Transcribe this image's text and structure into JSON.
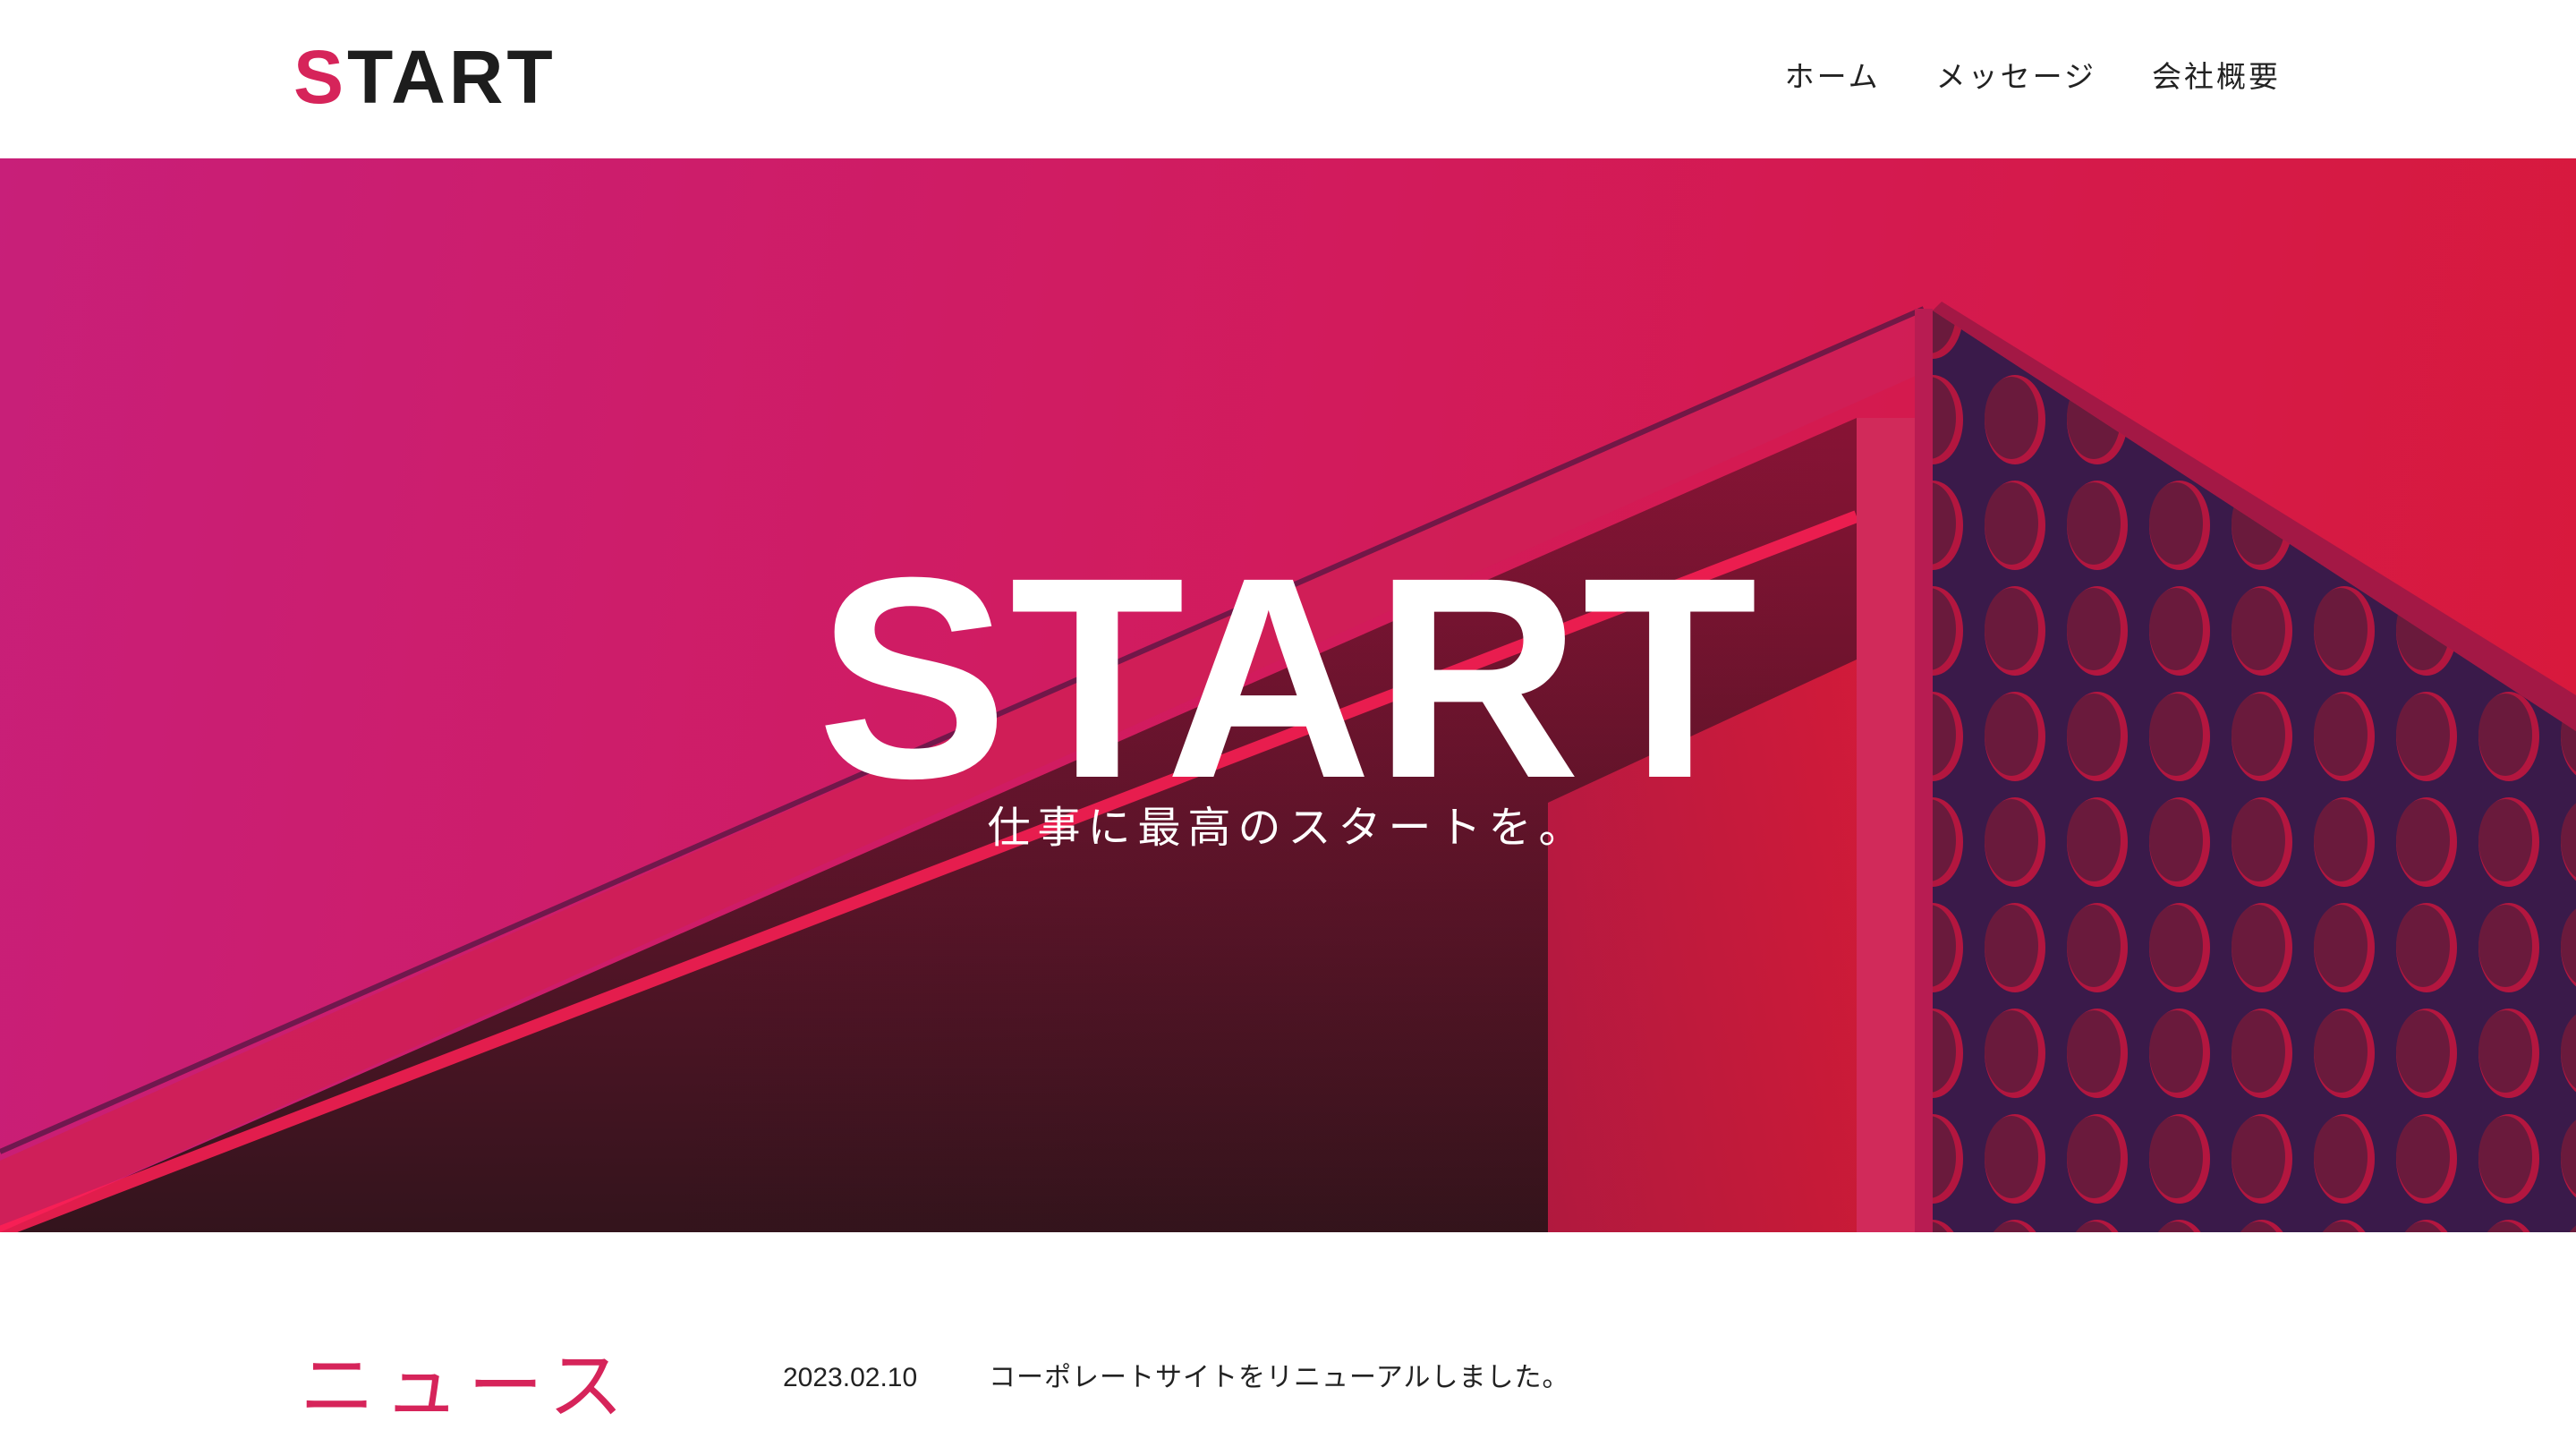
{
  "header": {
    "logo": {
      "first_letter": "S",
      "rest": "TART"
    },
    "nav": [
      {
        "label": "ホーム"
      },
      {
        "label": "メッセージ"
      },
      {
        "label": "会社概要"
      }
    ]
  },
  "hero": {
    "title": "START",
    "subtitle": "仕事に最高のスタートを。"
  },
  "news": {
    "heading": "ニュース",
    "items": [
      {
        "date": "2023.02.10",
        "text": "コーポレートサイトをリニューアルしました。"
      }
    ]
  },
  "colors": {
    "accent": "#d6245a",
    "hero_gradient_start": "#c81f79",
    "hero_gradient_end": "#d8193a",
    "text": "#222222"
  }
}
